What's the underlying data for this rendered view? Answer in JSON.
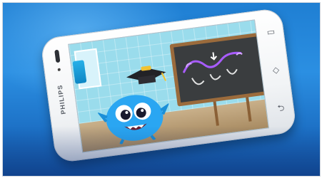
{
  "brand": "PHILIPS",
  "icons": [
    "speaker-icon",
    "camera-icon",
    "menu-key-icon",
    "home-key-icon",
    "back-key-icon",
    "graduation-cap-icon"
  ],
  "colors": {
    "background": "#1f7fd3",
    "phone_body": "#ffffff",
    "monster": "#2aa6f2",
    "board_frame": "#9b6b3c",
    "chalk_doodle": "#a85cff"
  }
}
